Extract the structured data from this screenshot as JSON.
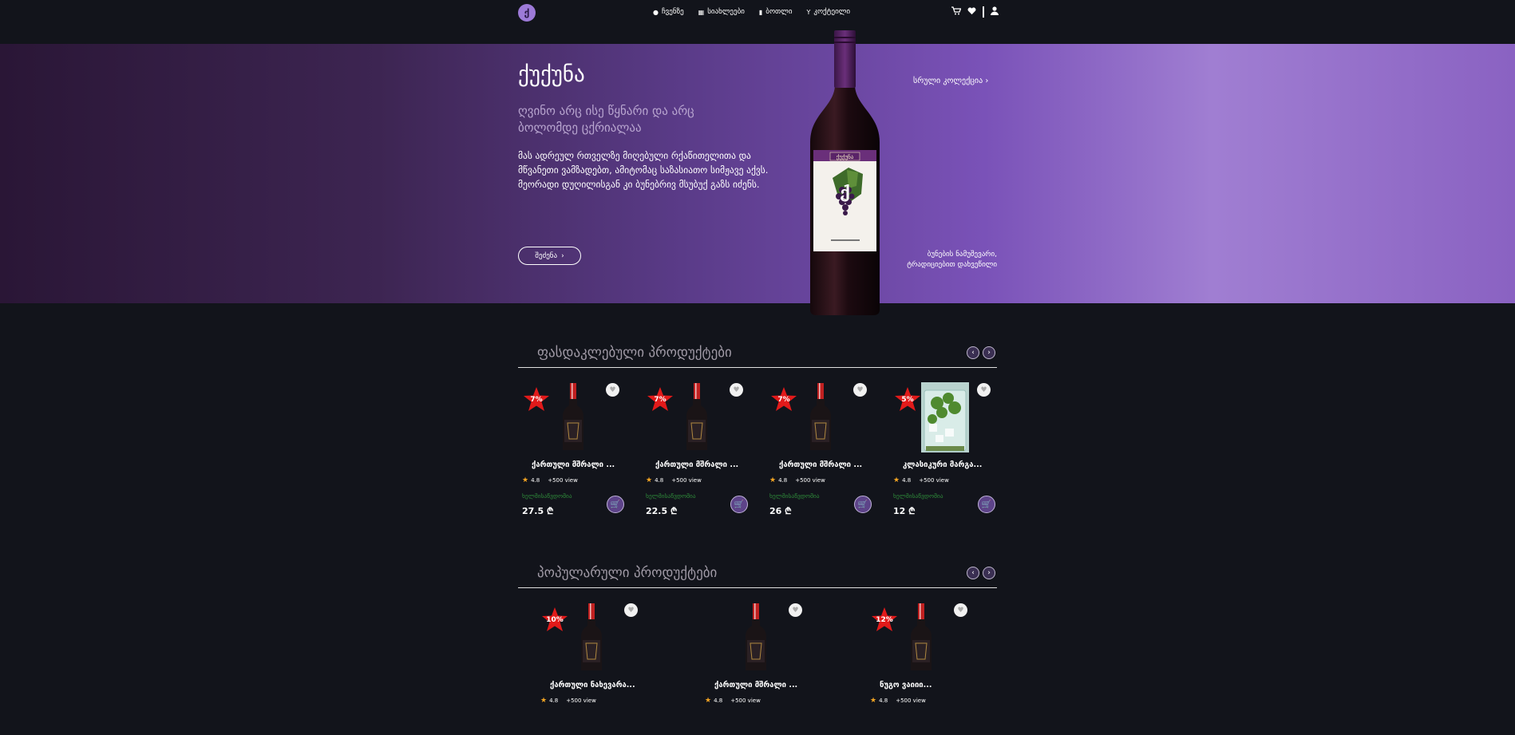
{
  "nav": {
    "logo_letter": "ქ",
    "items": [
      {
        "icon": "info-icon",
        "glyph": "●",
        "label": "ჩვენზე"
      },
      {
        "icon": "document-icon",
        "glyph": "▦",
        "label": "სიახლეები"
      },
      {
        "icon": "bottle-icon",
        "glyph": "▮",
        "label": "ბოთლი"
      },
      {
        "icon": "cocktail-icon",
        "glyph": "Y",
        "label": "კოქტეილი"
      }
    ],
    "icons": [
      "cart-icon",
      "heart-icon",
      "user-icon"
    ]
  },
  "hero": {
    "title": "ქუქუნა",
    "subtitle": "ღვინო არც ისე წყნარი და არც ბოლომდე ცქრიალაა",
    "text": "მას ადრეულ რთველზე მიღებული რქაწითელითა და მწვანეთი ვამზადებთ, ამიტომაც საზასიათო სიმჟავე აქვს. მეორადი დუღილისგან კი ბუნებრივ მსუბუქ გაზს იძენს.",
    "button_label": "შეძენა",
    "link_label": "სრული კოლექცია",
    "caption": "ბუნების ნამუშევარი, ტრადიციებით დახვეწილი",
    "bottle_label": "ქუქუნა",
    "colors": {
      "accent": "#7a52b8",
      "bottle_cap": "#5a2a6a",
      "label_band": "#6a2f7a"
    }
  },
  "sections": [
    {
      "title": "ფასდაკლებული პროდუქტები",
      "products": [
        {
          "name": "ქართული მშრალი ...",
          "discount": "7%",
          "rating": "4.8",
          "views": "+500 view",
          "stock": "ხელმისაწვდომია",
          "price": "27.5 ₾",
          "image": "wine-bottle"
        },
        {
          "name": "ქართული მშრალი ...",
          "discount": "7%",
          "rating": "4.8",
          "views": "+500 view",
          "stock": "ხელმისაწვდომია",
          "price": "22.5 ₾",
          "image": "wine-bottle"
        },
        {
          "name": "ქართული მშრალი ...",
          "discount": "7%",
          "rating": "4.8",
          "views": "+500 view",
          "stock": "ხელმისაწვდომია",
          "price": "26 ₾",
          "image": "wine-bottle"
        },
        {
          "name": "კლასიკური მარგა...",
          "discount": "5%",
          "rating": "4.8",
          "views": "+500 view",
          "stock": "ხელმისაწვდომია",
          "price": "12 ₾",
          "image": "cocktail-glass"
        }
      ]
    },
    {
      "title": "პოპულარული პროდუქტები",
      "products": [
        {
          "name": "ქართული ნახევარა...",
          "discount": "10%",
          "rating": "4.8",
          "views": "+500 view"
        },
        {
          "name": "ქართული მშრალი ...",
          "discount": "",
          "rating": "4.8",
          "views": "+500 view"
        },
        {
          "name": "ნუგო ვაიიი...",
          "discount": "12%",
          "rating": "4.8",
          "views": "+500 view"
        }
      ]
    }
  ]
}
